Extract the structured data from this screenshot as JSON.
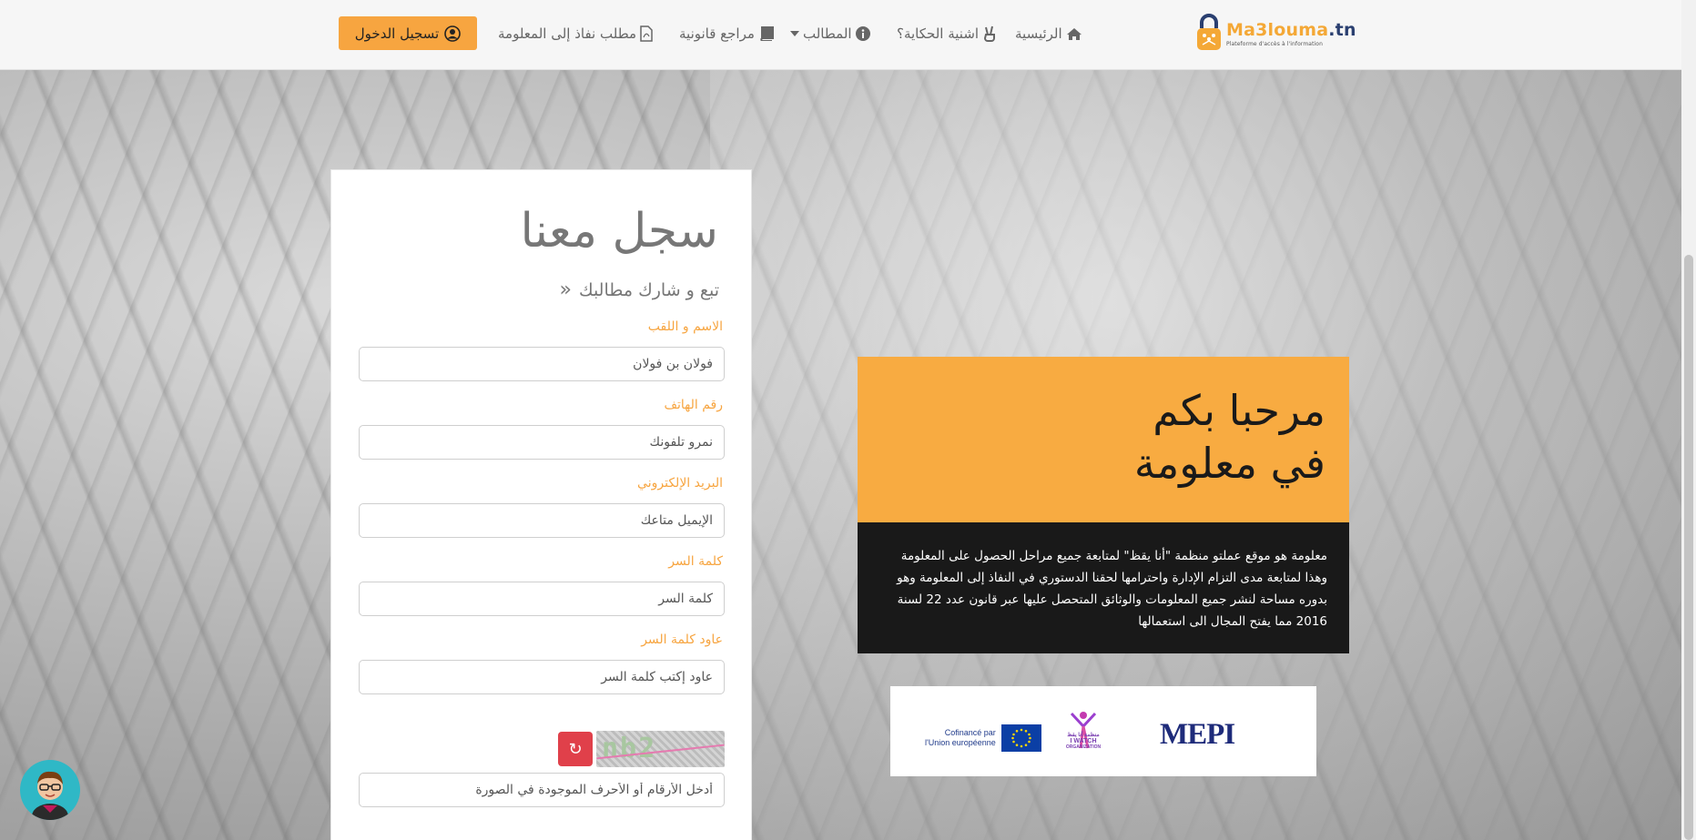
{
  "brand": {
    "name_main": "Ma3louma",
    "name_tld": ".tn",
    "tagline": "Plateforme d'accès à l'information",
    "accent": "#f7a540",
    "dark": "#2a3f70"
  },
  "nav": {
    "home": "الرئيسية",
    "story": "اشنية الحكاية؟",
    "demands": "المطالب",
    "legal": "مراجع قانونية",
    "request": "مطلب نفاذ إلى المعلومة",
    "login": "تسجيل الدخول"
  },
  "form": {
    "title": "سجل معنا",
    "subtitle": "تبع و شارك مطالبك",
    "fields": [
      {
        "label": "الاسم و اللقب",
        "placeholder": "فولان بن فولان"
      },
      {
        "label": "رقم الهاتف",
        "placeholder": "نمرو تلفونك"
      },
      {
        "label": "البريد الإلكتروني",
        "placeholder": "الإيميل متاعك"
      },
      {
        "label": "كلمة السر",
        "placeholder": "كلمة السر"
      },
      {
        "label": "عاود كلمة السر",
        "placeholder": "عاود إكتب كلمة السر"
      }
    ],
    "captcha_text": "nb2",
    "refresh_symbol": "↻",
    "captcha_placeholder": "أدخل الأرقام أو الأحرف الموجودة في الصورة"
  },
  "welcome": {
    "line1": "مرحبا بكم",
    "line2": "في معلومة",
    "description": "معلومة هو موقع عملتو منظمة \"أنا يقظ\" لمتابعة جميع مراحل الحصول على المعلومة وهذا لمتابعة مدى التزام الإدارة واحترامها لحقنا الدستوري في النفاذ إلى المعلومة وهو بدوره مساحة لنشر جميع المعلومات والوثائق المتحصل عليها عبر قانون عدد 22 لسنة 2016 مما يفتح المجال الى استعمالها"
  },
  "sponsors": {
    "eu_line1": "Cofinancé par",
    "eu_line2": "l'Union européenne",
    "iwatch": "I WATCH",
    "iwatch_ar": "منظمة أنا يقظ",
    "iwatch_org": "ORGANIZATION",
    "mepi": "MEPI"
  },
  "colors": {
    "orange": "#f8ab41",
    "dark_panel": "#191919",
    "refresh": "#e0404a",
    "avatar_bg": "#2fb8c6"
  }
}
